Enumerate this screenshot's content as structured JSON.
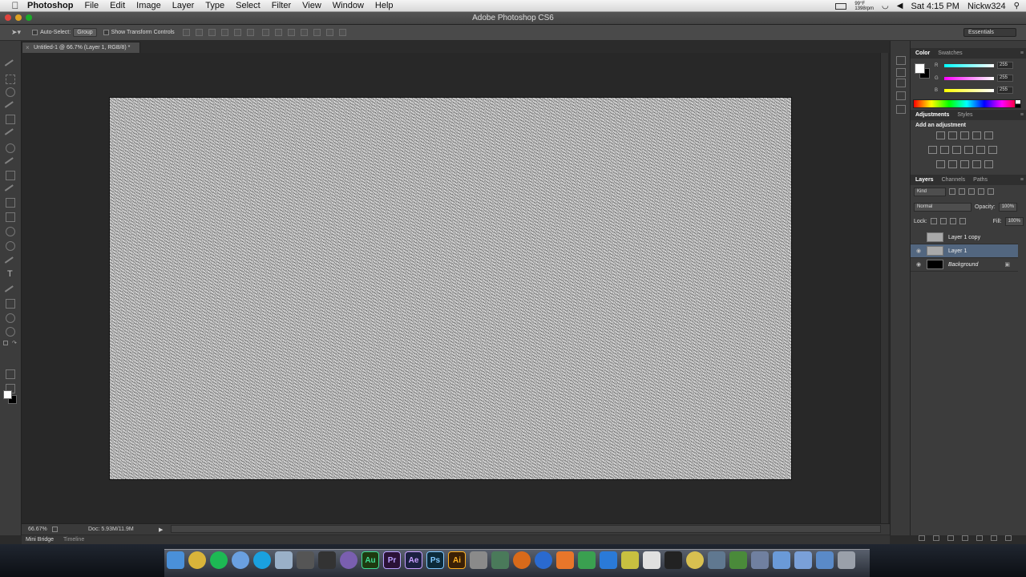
{
  "menubar": {
    "app_name": "Photoshop",
    "items": [
      "File",
      "Edit",
      "Image",
      "Layer",
      "Type",
      "Select",
      "Filter",
      "View",
      "Window",
      "Help"
    ],
    "battery_top": "99°F",
    "battery_bottom": "1398rpm",
    "clock": "Sat 4:15 PM",
    "user": "Nickw324"
  },
  "window": {
    "title": "Adobe Photoshop CS6"
  },
  "options": {
    "auto_select_label": "Auto-Select:",
    "auto_select_value": "Group",
    "show_transform_label": "Show Transform Controls",
    "workspace": "Essentials"
  },
  "document": {
    "tab_label": "Untitled-1 @ 66.7% (Layer 1, RGB/8) *",
    "zoom": "66.67%",
    "doc_size": "Doc: 5.93M/11.9M"
  },
  "bottom_tabs": [
    "Mini Bridge",
    "Timeline"
  ],
  "color_panel": {
    "tabs": [
      "Color",
      "Swatches"
    ],
    "r_label": "R",
    "r_value": "255",
    "g_label": "G",
    "g_value": "255",
    "b_label": "B",
    "b_value": "255"
  },
  "adjustments_panel": {
    "tabs": [
      "Adjustments",
      "Styles"
    ],
    "title": "Add an adjustment"
  },
  "layers_panel": {
    "tabs": [
      "Layers",
      "Channels",
      "Paths"
    ],
    "kind": "Kind",
    "blend_mode": "Normal",
    "opacity_label": "Opacity:",
    "opacity_value": "100%",
    "lock_label": "Lock:",
    "fill_label": "Fill:",
    "fill_value": "100%",
    "layers": [
      {
        "name": "Layer 1 copy",
        "visible": false,
        "selected": false
      },
      {
        "name": "Layer 1",
        "visible": true,
        "selected": true
      },
      {
        "name": "Background",
        "visible": true,
        "selected": false,
        "locked": true
      }
    ]
  },
  "dock": {
    "apps": [
      "finder-icon",
      "chrome-icon",
      "spotify-icon",
      "itunes-icon",
      "skype-icon",
      "preview-icon",
      "final-cut-icon",
      "clapper-icon",
      "colorsync-icon",
      "Au",
      "Pr",
      "Ae",
      "Ps",
      "Ai",
      "settings-icon",
      "screen-sharing-icon",
      "firefox-icon",
      "quicktime-icon",
      "vlc-icon",
      "google-drive-icon",
      "dropbox-icon",
      "utility-icon",
      "pen-icon",
      "activity-monitor-icon",
      "burn-icon",
      "xcode-icon",
      "minecraft-icon",
      "migration-icon",
      "folder-icon",
      "folder-icon",
      "downloads-icon",
      "trash-icon"
    ]
  }
}
